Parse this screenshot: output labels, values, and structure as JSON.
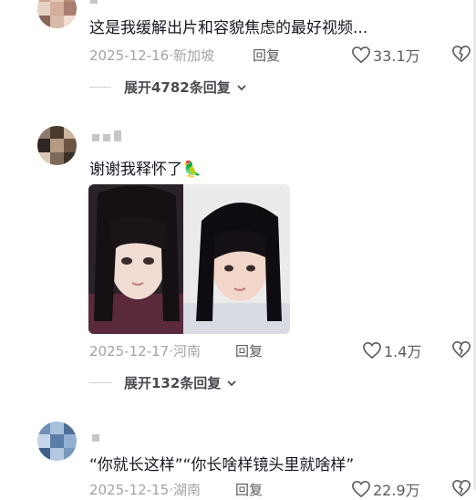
{
  "comments": [
    {
      "text": "这是我缓解出片和容貌焦虑的最好视频...",
      "date": "2025-12-16",
      "location": "新加坡",
      "reply_label": "回复",
      "likes": "33.1万",
      "expand_label": "展开4782条回复",
      "avatar_icon": "user-avatar"
    },
    {
      "text": "谢谢我释怀了",
      "emoji": "🦜",
      "date": "2025-12-17",
      "location": "河南",
      "reply_label": "回复",
      "likes": "1.4万",
      "expand_label": "展开132条回复",
      "avatar_icon": "user-avatar"
    },
    {
      "text": "“你就长这样”“你长啥样镜头里就啥样”",
      "date": "2025-12-15",
      "location": "湖南",
      "reply_label": "回复",
      "likes": "22.9万",
      "avatar_icon": "user-avatar"
    }
  ],
  "colors": {
    "text": "#161823",
    "meta": "#a3a3a8",
    "secondary": "#5a5a60"
  },
  "icons": [
    "heart-outline-icon",
    "broken-heart-outline-icon",
    "chevron-down-icon"
  ]
}
